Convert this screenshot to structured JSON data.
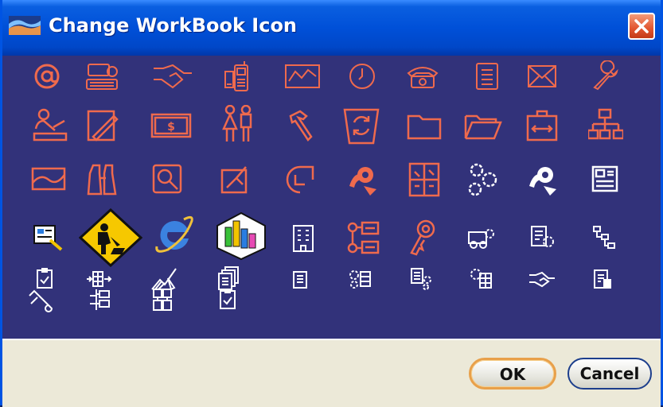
{
  "window": {
    "title": "Change WorkBook Icon",
    "title_icon": "workbook-flag-icon",
    "close_icon": "close-icon"
  },
  "icons": [
    "at-sign-icon",
    "keyboard-key-icon",
    "handshake-icon",
    "cell-phone-icon",
    "line-chart-icon",
    "clock-icon",
    "telephone-icon",
    "notepad-icon",
    "envelope-icon",
    "wrench-icon",
    "user-at-desk-icon",
    "pencil-paper-icon",
    "dollar-bill-icon",
    "people-icon",
    "hammer-icon",
    "recycle-bin-icon",
    "folder-closed-icon",
    "folder-open-icon",
    "transfer-box-icon",
    "org-chart-icon",
    "network-link-icon",
    "binoculars-icon",
    "magnifier-icon",
    "document-edit-icon",
    "refresh-arrows-icon",
    "gear-arrow-icon",
    "document-grid-icon",
    "gears-icon",
    "gear-cycle-icon",
    "form-icon",
    "key-card-icon",
    "construction-worker-icon",
    "internet-explorer-icon",
    "bar-chart-3d-icon",
    "building-icon",
    "process-flow-icon",
    "key-person-icon",
    "car-gears-icon",
    "document-gear-icon",
    "small-flowchart-icon",
    "checklist-icon",
    "arrow-grid-icon",
    "chart-pencil-icon",
    "stacked-documents-icon",
    "text-document-icon",
    "gear-table-icon",
    "document-gears-icon",
    "gear-panel-icon",
    "handshake-small-icon",
    "report-icon",
    "tools-icon",
    "tree-structure-icon",
    "module-grid-icon",
    "clipboard-check-icon"
  ],
  "footer": {
    "ok_label": "OK",
    "cancel_label": "Cancel"
  },
  "colors": {
    "titlebar": "#0050d8",
    "grid_background": "#32327a",
    "icon_stroke": "#ef6a4d",
    "small_icon_stroke": "#ffffff",
    "dialog_background": "#ece9d8",
    "ok_border": "#e8a04a"
  }
}
